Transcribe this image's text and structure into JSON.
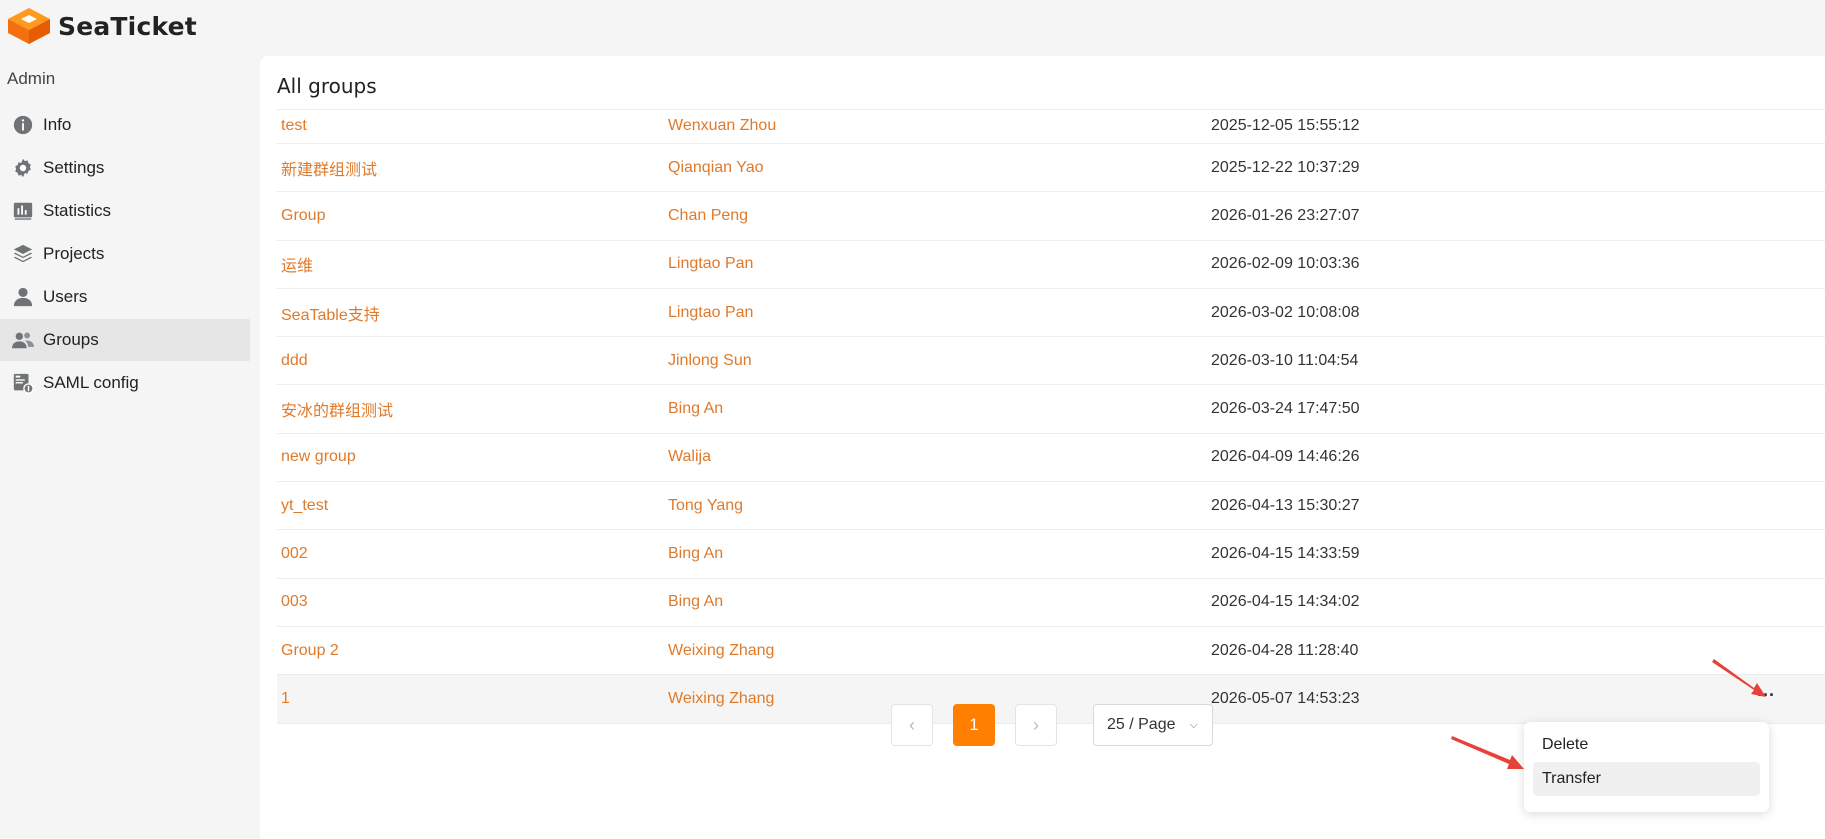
{
  "app": {
    "name": "SeaTicket"
  },
  "sidebar": {
    "title": "Admin",
    "items": [
      {
        "label": "Info",
        "icon": "info-icon"
      },
      {
        "label": "Settings",
        "icon": "gear-icon"
      },
      {
        "label": "Statistics",
        "icon": "chart-icon"
      },
      {
        "label": "Projects",
        "icon": "layers-icon"
      },
      {
        "label": "Users",
        "icon": "user-icon"
      },
      {
        "label": "Groups",
        "icon": "users-icon"
      },
      {
        "label": "SAML config",
        "icon": "saml-icon"
      }
    ]
  },
  "main": {
    "title": "All groups",
    "rows": [
      {
        "name": "test",
        "owner": "Wenxuan Zhou",
        "created": "2025-12-05 15:55:12"
      },
      {
        "name": "新建群组测试",
        "owner": "Qianqian Yao",
        "created": "2025-12-22 10:37:29"
      },
      {
        "name": "Group",
        "owner": "Chan Peng",
        "created": "2026-01-26 23:27:07"
      },
      {
        "name": "运维",
        "owner": "Lingtao Pan",
        "created": "2026-02-09 10:03:36"
      },
      {
        "name": "SeaTable支持",
        "owner": "Lingtao Pan",
        "created": "2026-03-02 10:08:08"
      },
      {
        "name": "ddd",
        "owner": "Jinlong Sun",
        "created": "2026-03-10 11:04:54"
      },
      {
        "name": "安冰的群组测试",
        "owner": "Bing An",
        "created": "2026-03-24 17:47:50"
      },
      {
        "name": "new group",
        "owner": "Walija",
        "created": "2026-04-09 14:46:26"
      },
      {
        "name": "yt_test",
        "owner": "Tong Yang",
        "created": "2026-04-13 15:30:27"
      },
      {
        "name": "002",
        "owner": "Bing An",
        "created": "2026-04-15 14:33:59"
      },
      {
        "name": "003",
        "owner": "Bing An",
        "created": "2026-04-15 14:34:02"
      },
      {
        "name": "Group 2",
        "owner": "Weixing Zhang",
        "created": "2026-04-28 11:28:40"
      },
      {
        "name": "1",
        "owner": "Weixing Zhang",
        "created": "2026-05-07 14:53:23"
      }
    ],
    "more_label": "···"
  },
  "pagination": {
    "prev": "‹",
    "current_page": "1",
    "next": "›",
    "page_size": "25 / Page"
  },
  "menu": {
    "delete_label": "Delete",
    "transfer_label": "Transfer"
  },
  "colors": {
    "accent": "#ff8000",
    "link": "#e07a2b",
    "arrow": "#e8413a"
  }
}
